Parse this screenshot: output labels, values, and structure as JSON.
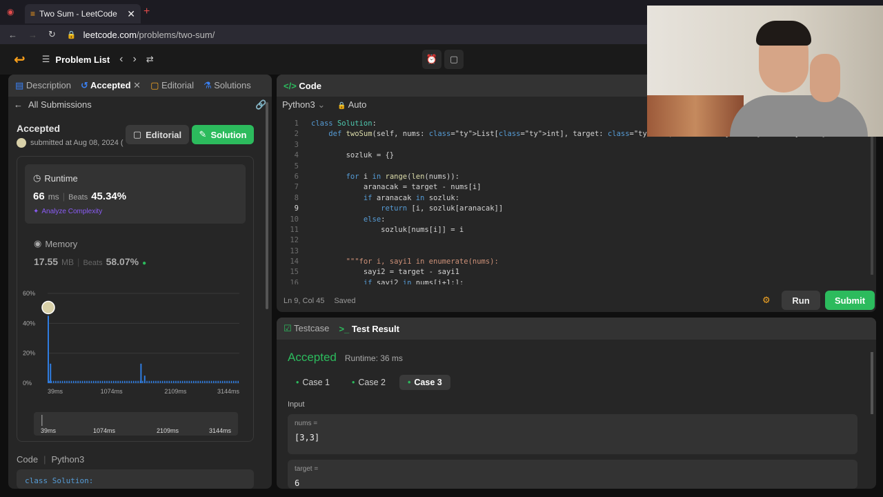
{
  "browser": {
    "tab_title": "Two Sum - LeetCode",
    "url_host": "leetcode.com",
    "url_path": "/problems/two-sum/"
  },
  "header": {
    "problem_list": "Problem List"
  },
  "left_tabs": [
    "Description",
    "Accepted",
    "Editorial",
    "Solutions"
  ],
  "submission": {
    "back_label": "All Submissions",
    "status": "Accepted",
    "submitted": "submitted at Aug 08, 2024 (",
    "editorial_btn": "Editorial",
    "solution_btn": "Solution",
    "runtime_label": "Runtime",
    "runtime_value": "66",
    "runtime_unit": "ms",
    "runtime_beats_label": "Beats",
    "runtime_beats": "45.34%",
    "analyze": "Analyze Complexity",
    "memory_label": "Memory",
    "memory_value": "17.55",
    "memory_unit": "MB",
    "memory_beats_label": "Beats",
    "memory_beats": "58.07%",
    "code_label": "Code",
    "code_lang": "Python3",
    "code_preview": "class Solution:"
  },
  "chart_data": {
    "type": "bar",
    "y_ticks": [
      "60%",
      "40%",
      "20%",
      "0%"
    ],
    "x_ticks": [
      "39ms",
      "1074ms",
      "2109ms",
      "3144ms"
    ],
    "ylim": [
      0,
      60
    ],
    "x_range_ms": [
      39,
      3144
    ],
    "peaks": [
      {
        "x": 39,
        "y": 45
      },
      {
        "x": 75,
        "y": 13
      },
      {
        "x": 1540,
        "y": 13
      },
      {
        "x": 1600,
        "y": 5
      }
    ],
    "baseline_value": 1.5,
    "bar_color": "#2f7de1"
  },
  "editor": {
    "title": "Code",
    "language": "Python3",
    "mode": "Auto",
    "status_pos": "Ln 9, Col 45",
    "status_saved": "Saved",
    "run_btn": "Run",
    "submit_btn": "Submit",
    "lines": [
      {
        "n": "1",
        "text": "class Solution:"
      },
      {
        "n": "2",
        "text": "    def twoSum(self, nums: List[int], target: int) -> List[int]:"
      },
      {
        "n": "3",
        "text": ""
      },
      {
        "n": "4",
        "text": "        sozluk = {}"
      },
      {
        "n": "5",
        "text": ""
      },
      {
        "n": "6",
        "text": "        for i in range(len(nums)):"
      },
      {
        "n": "7",
        "text": "            aranacak = target - nums[i]"
      },
      {
        "n": "8",
        "text": "            if aranacak in sozluk:"
      },
      {
        "n": "9",
        "text": "                return [i, sozluk[aranacak]]"
      },
      {
        "n": "10",
        "text": "            else:"
      },
      {
        "n": "11",
        "text": "                sozluk[nums[i]] = i"
      },
      {
        "n": "12",
        "text": ""
      },
      {
        "n": "13",
        "text": ""
      },
      {
        "n": "14",
        "text": "        \"\"\"for i, sayi1 in enumerate(nums):"
      },
      {
        "n": "15",
        "text": "            sayi2 = target - sayi1"
      },
      {
        "n": "16",
        "text": "            if sayi2 in nums[i+1:]:"
      }
    ]
  },
  "result": {
    "tab_testcase": "Testcase",
    "tab_result": "Test Result",
    "status": "Accepted",
    "runtime": "Runtime: 36 ms",
    "cases": [
      "Case 1",
      "Case 2",
      "Case 3"
    ],
    "input_label": "Input",
    "nums_label": "nums =",
    "nums_value": "[3,3]",
    "target_label": "target =",
    "target_value": "6"
  }
}
